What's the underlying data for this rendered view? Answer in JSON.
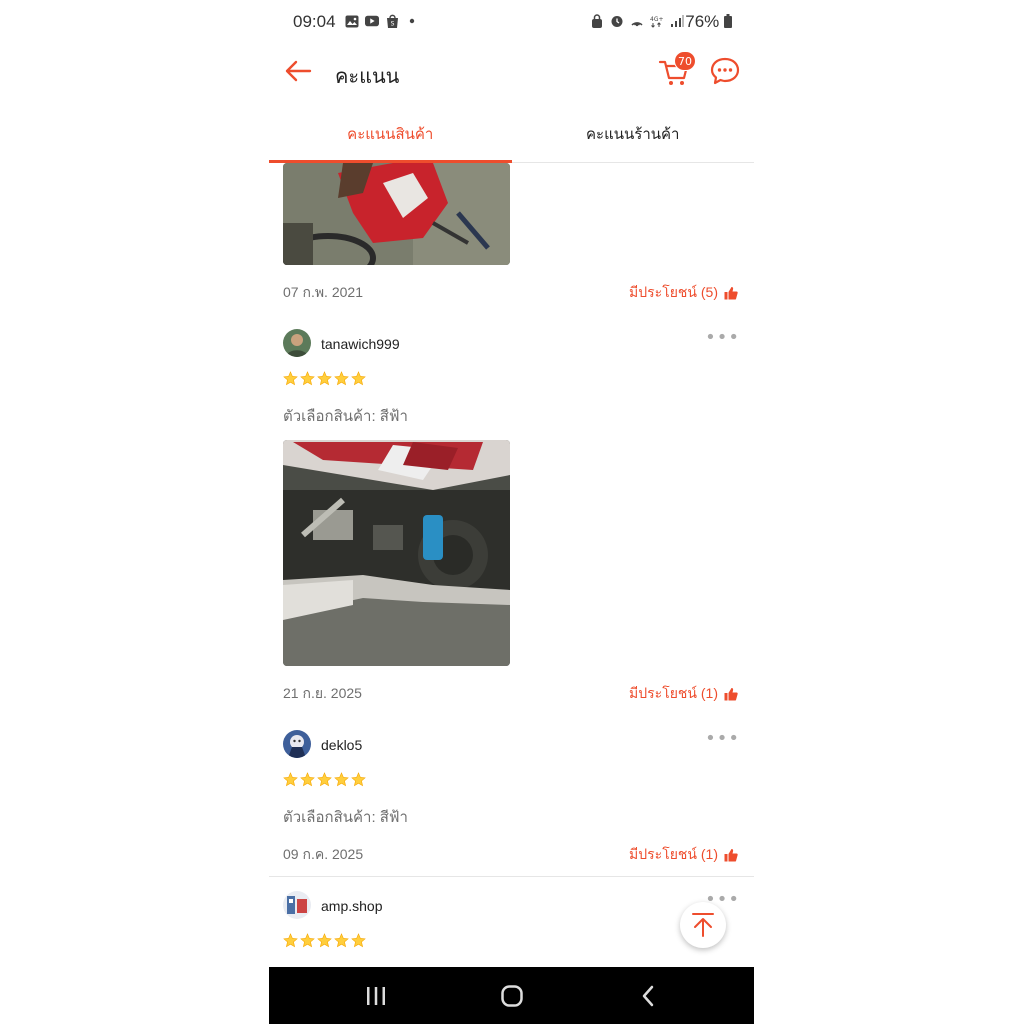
{
  "status_bar": {
    "time": "09:04",
    "battery": "76%",
    "left_icons": [
      "gallery-icon",
      "youtube-icon",
      "shopee-bag-icon",
      "dot-icon"
    ],
    "right_icons": [
      "lock-icon",
      "alarm-icon",
      "nfc-icon",
      "lte-icon",
      "signal-icon",
      "battery-icon"
    ]
  },
  "header": {
    "title": "คะแนน",
    "cart_count": "70",
    "accent_color": "#ee4d2d"
  },
  "tabs": [
    {
      "label": "คะแนนสินค้า",
      "active": true
    },
    {
      "label": "คะแนนร้านค้า",
      "active": false
    }
  ],
  "reviews": [
    {
      "date": "07 ก.พ. 2021",
      "helpful": "มีประโยชน์ (5)",
      "photo": "red-motorcycle-photo"
    },
    {
      "username": "tanawich999",
      "rating": 5,
      "variant": "ตัวเลือกสินค้า: สีฟ้า",
      "photo": "motorcycle-engine-photo",
      "date": "21 ก.ย. 2025",
      "helpful": "มีประโยชน์ (1)"
    },
    {
      "username": "deklo5",
      "rating": 5,
      "variant": "ตัวเลือกสินค้า: สีฟ้า",
      "date": "09 ก.ค. 2025",
      "helpful": "มีประโยชน์ (1)"
    },
    {
      "username": "amp.shop",
      "rating": 5
    }
  ],
  "more_label": "•••"
}
